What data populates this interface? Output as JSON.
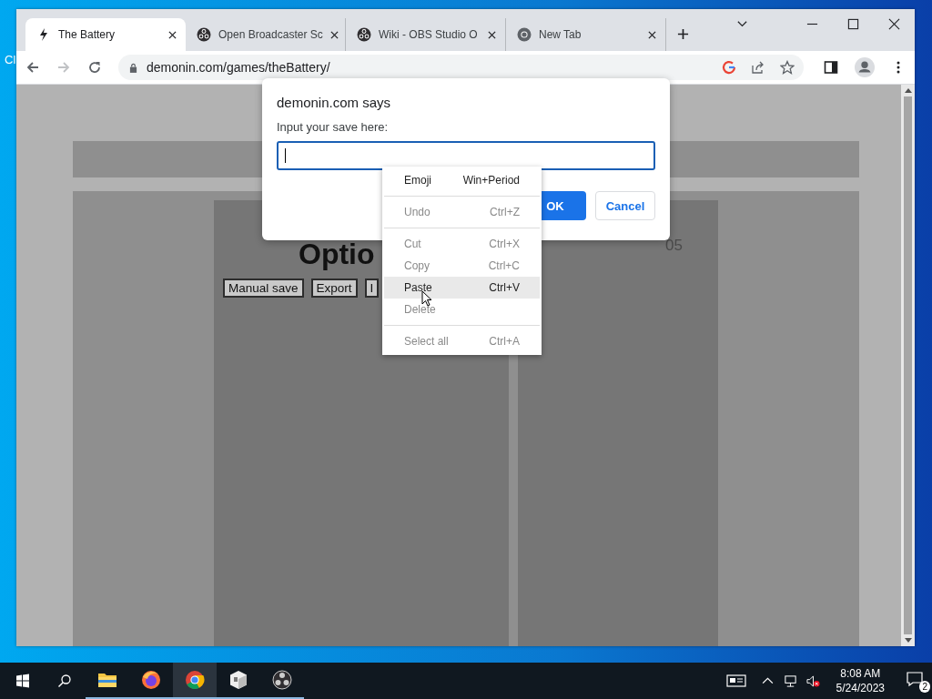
{
  "desktop": {
    "icon_label": "Cl"
  },
  "browser": {
    "tabs": [
      {
        "title": "The Battery",
        "kind": "bolt",
        "selected": true
      },
      {
        "title": "Open Broadcaster Sc",
        "kind": "obs",
        "selected": false
      },
      {
        "title": "Wiki - OBS Studio O",
        "kind": "obs",
        "selected": false
      },
      {
        "title": "New Tab",
        "kind": "chrome",
        "selected": false
      }
    ],
    "address": "demonin.com/games/theBattery/"
  },
  "page": {
    "heading": "Optio",
    "side_number": "05",
    "buttons": [
      "Manual save",
      "Export",
      "I"
    ]
  },
  "dialog": {
    "title": "demonin.com says",
    "prompt": "Input your save here:",
    "ok": "OK",
    "cancel": "Cancel"
  },
  "context_menu": {
    "groups": [
      [
        {
          "label": "Emoji",
          "shortcut": "Win+Period",
          "disabled": false,
          "highlighted": false
        }
      ],
      [
        {
          "label": "Undo",
          "shortcut": "Ctrl+Z",
          "disabled": true,
          "highlighted": false
        }
      ],
      [
        {
          "label": "Cut",
          "shortcut": "Ctrl+X",
          "disabled": true,
          "highlighted": false
        },
        {
          "label": "Copy",
          "shortcut": "Ctrl+C",
          "disabled": true,
          "highlighted": false
        },
        {
          "label": "Paste",
          "shortcut": "Ctrl+V",
          "disabled": false,
          "highlighted": true
        },
        {
          "label": "Delete",
          "disabled": true,
          "highlighted": false
        }
      ],
      [
        {
          "label": "Select all",
          "shortcut": "Ctrl+A",
          "disabled": true,
          "highlighted": false
        }
      ]
    ]
  },
  "taskbar": {
    "apps": [
      {
        "kind": "folder",
        "selected": false
      },
      {
        "kind": "firefox",
        "selected": false
      },
      {
        "kind": "chrome",
        "selected": true
      },
      {
        "kind": "box",
        "selected": false
      },
      {
        "kind": "obs",
        "selected": false
      }
    ],
    "time": "8:08 AM",
    "date": "5/24/2023",
    "notifications": "2"
  }
}
